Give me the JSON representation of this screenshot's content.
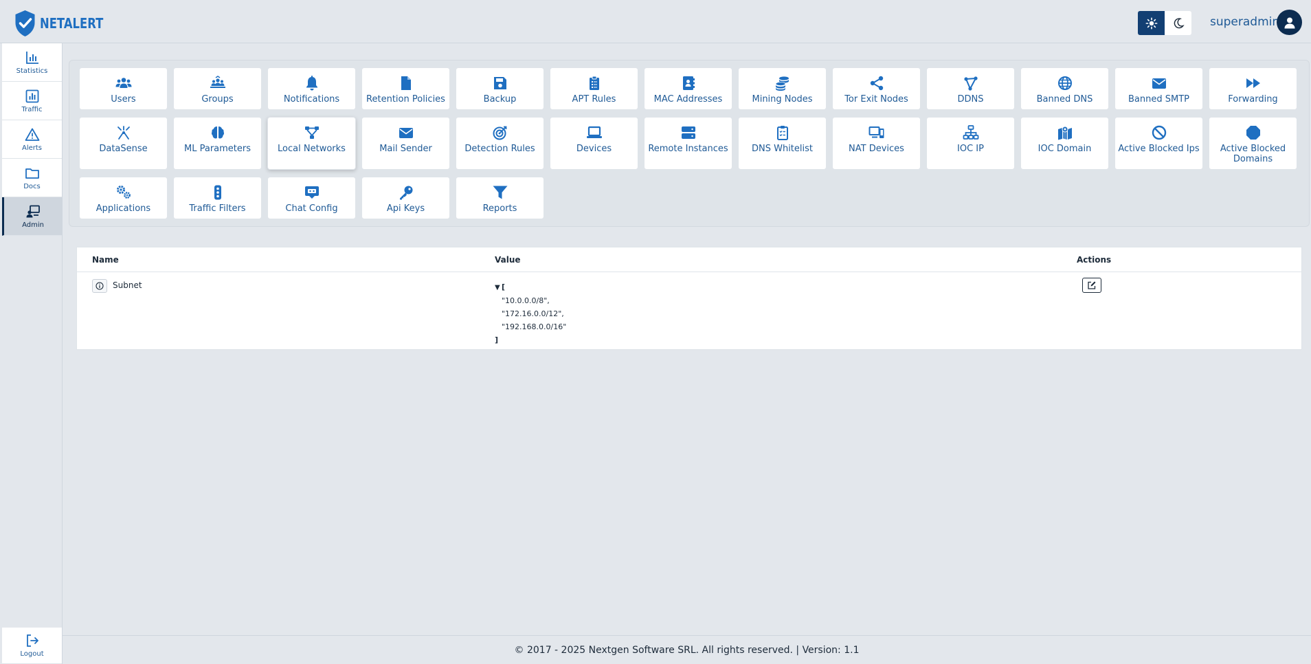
{
  "header": {
    "logo_text": "NETALERT",
    "user_name": "superadmin"
  },
  "sidebar": {
    "items": [
      {
        "label": "Statistics",
        "icon": "bar-chart-icon"
      },
      {
        "label": "Traffic",
        "icon": "chart-box-icon"
      },
      {
        "label": "Alerts",
        "icon": "warning-icon"
      },
      {
        "label": "Docs",
        "icon": "folder-icon"
      },
      {
        "label": "Admin",
        "icon": "admin-screen-icon",
        "active": true
      }
    ],
    "logout_label": "Logout"
  },
  "admin_cards": [
    {
      "label": "Users",
      "icon": "users-icon"
    },
    {
      "label": "Groups",
      "icon": "groups-icon"
    },
    {
      "label": "Notifications",
      "icon": "bell-icon"
    },
    {
      "label": "Retention Policies",
      "icon": "file-icon"
    },
    {
      "label": "Backup",
      "icon": "floppy-icon"
    },
    {
      "label": "APT Rules",
      "icon": "clipboard-list-icon"
    },
    {
      "label": "MAC Addresses",
      "icon": "address-book-icon"
    },
    {
      "label": "Mining Nodes",
      "icon": "coins-icon"
    },
    {
      "label": "Tor Exit Nodes",
      "icon": "share-icon"
    },
    {
      "label": "DDNS",
      "icon": "nodes-icon"
    },
    {
      "label": "Banned DNS",
      "icon": "globe-icon"
    },
    {
      "label": "Banned SMTP",
      "icon": "envelope-icon"
    },
    {
      "label": "Forwarding",
      "icon": "forward-icon"
    },
    {
      "label": "DataSense",
      "icon": "sparkle-icon"
    },
    {
      "label": "ML Parameters",
      "icon": "brain-icon"
    },
    {
      "label": "Local Networks",
      "icon": "network-icon",
      "active": true
    },
    {
      "label": "Mail Sender",
      "icon": "envelope-icon"
    },
    {
      "label": "Detection Rules",
      "icon": "target-icon"
    },
    {
      "label": "Devices",
      "icon": "laptop-icon"
    },
    {
      "label": "Remote Instances",
      "icon": "server-icon"
    },
    {
      "label": "DNS Whitelist",
      "icon": "clipboard-check-icon"
    },
    {
      "label": "NAT Devices",
      "icon": "devices-icon"
    },
    {
      "label": "IOC IP",
      "icon": "sitemap-icon"
    },
    {
      "label": "IOC Domain",
      "icon": "map-icon"
    },
    {
      "label": "Active Blocked Ips",
      "icon": "ban-icon"
    },
    {
      "label": "Active Blocked Domains",
      "icon": "stop-icon"
    },
    {
      "label": "Applications",
      "icon": "gears-icon"
    },
    {
      "label": "Traffic Filters",
      "icon": "traffic-light-icon"
    },
    {
      "label": "Chat Config",
      "icon": "chat-robot-icon"
    },
    {
      "label": "Api Keys",
      "icon": "key-icon"
    },
    {
      "label": "Reports",
      "icon": "filter-icon"
    }
  ],
  "table": {
    "columns": {
      "name": "Name",
      "value": "Value",
      "actions": "Actions"
    },
    "rows": [
      {
        "name": "Subnet",
        "value_lines": [
          "[",
          "\"10.0.0.0/8\",",
          "\"172.16.0.0/12\",",
          "\"192.168.0.0/16\"",
          "]"
        ]
      }
    ]
  },
  "footer": {
    "text": "© 2017 - 2025 Nextgen Software SRL. All rights reserved. | Version: 1.1"
  },
  "colors": {
    "accent": "#1f6fc1",
    "dark": "#0c2c50",
    "background": "#e3e7ec"
  }
}
